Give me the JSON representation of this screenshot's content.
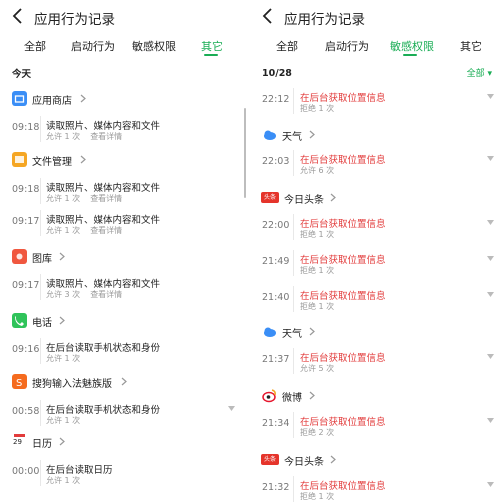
{
  "left": {
    "title": "应用行为记录",
    "tabs": [
      "全部",
      "启动行为",
      "敏感权限",
      "其它"
    ],
    "active_tab": 3,
    "section_label": "今天",
    "groups": [
      {
        "app": "应用商店",
        "icon": "app-store-icon",
        "color": "#3a8ef6",
        "records": [
          {
            "time": "09:18",
            "title": "读取照片、媒体内容和文件",
            "status": "允许 1 次",
            "detail": "查看详情"
          }
        ]
      },
      {
        "app": "文件管理",
        "icon": "file-manager-icon",
        "color": "#f5a623",
        "records": [
          {
            "time": "09:18",
            "title": "读取照片、媒体内容和文件",
            "status": "允许 1 次",
            "detail": "查看详情"
          },
          {
            "time": "09:17",
            "title": "读取照片、媒体内容和文件",
            "status": "允许 1 次",
            "detail": "查看详情"
          }
        ]
      },
      {
        "app": "图库",
        "icon": "gallery-icon",
        "color": "#f0573f",
        "records": [
          {
            "time": "09:17",
            "title": "读取照片、媒体内容和文件",
            "status": "允许 3 次",
            "detail": "查看详情"
          }
        ]
      },
      {
        "app": "电话",
        "icon": "phone-icon",
        "color": "#2fc35a",
        "records": [
          {
            "time": "09:16",
            "title": "在后台读取手机状态和身份",
            "status": "允许 1 次",
            "detail": ""
          }
        ]
      },
      {
        "app": "搜狗输入法魅族版",
        "icon": "sogou-input-icon",
        "color": "#f56b1e",
        "records": [
          {
            "time": "00:58",
            "title": "在后台读取手机状态和身份",
            "status": "允许 1 次",
            "detail": ""
          }
        ]
      },
      {
        "app": "日历",
        "icon": "calendar-icon",
        "color": "#e23b3b",
        "icon_text": "29",
        "records": [
          {
            "time": "00:00",
            "title": "在后台读取日历",
            "status": "允许 1 次",
            "detail": ""
          }
        ]
      }
    ]
  },
  "right": {
    "title": "应用行为记录",
    "tabs": [
      "全部",
      "启动行为",
      "敏感权限",
      "其它"
    ],
    "active_tab": 2,
    "date": "10/28",
    "filter_label": "全部",
    "groups": [
      {
        "app": "",
        "icon": "",
        "records": [
          {
            "time": "22:12",
            "title": "在后台获取位置信息",
            "status": "拒绝 1 次"
          }
        ]
      },
      {
        "app": "天气",
        "icon": "weather-icon",
        "color": "#3a8ef6",
        "records": [
          {
            "time": "22:03",
            "title": "在后台获取位置信息",
            "status": "允许 6 次"
          }
        ]
      },
      {
        "app": "今日头条",
        "icon": "toutiao-icon",
        "color": "#e5342b",
        "badge_text": "头条",
        "records": [
          {
            "time": "22:00",
            "title": "在后台获取位置信息",
            "status": "拒绝 1 次"
          },
          {
            "time": "21:49",
            "title": "在后台获取位置信息",
            "status": "拒绝 1 次"
          },
          {
            "time": "21:40",
            "title": "在后台获取位置信息",
            "status": "拒绝 1 次"
          }
        ]
      },
      {
        "app": "天气",
        "icon": "weather-icon",
        "color": "#3a8ef6",
        "records": [
          {
            "time": "21:37",
            "title": "在后台获取位置信息",
            "status": "允许 5 次"
          }
        ]
      },
      {
        "app": "微博",
        "icon": "weibo-icon",
        "color": "#e6162d",
        "records": [
          {
            "time": "21:34",
            "title": "在后台获取位置信息",
            "status": "拒绝 2 次"
          }
        ]
      },
      {
        "app": "今日头条",
        "icon": "toutiao-icon",
        "color": "#e5342b",
        "badge_text": "头条",
        "records": [
          {
            "time": "21:32",
            "title": "在后台获取位置信息",
            "status": "拒绝 1 次"
          }
        ]
      }
    ]
  },
  "colors": {
    "accent": "#1aad55",
    "alert": "#e23b3b"
  }
}
